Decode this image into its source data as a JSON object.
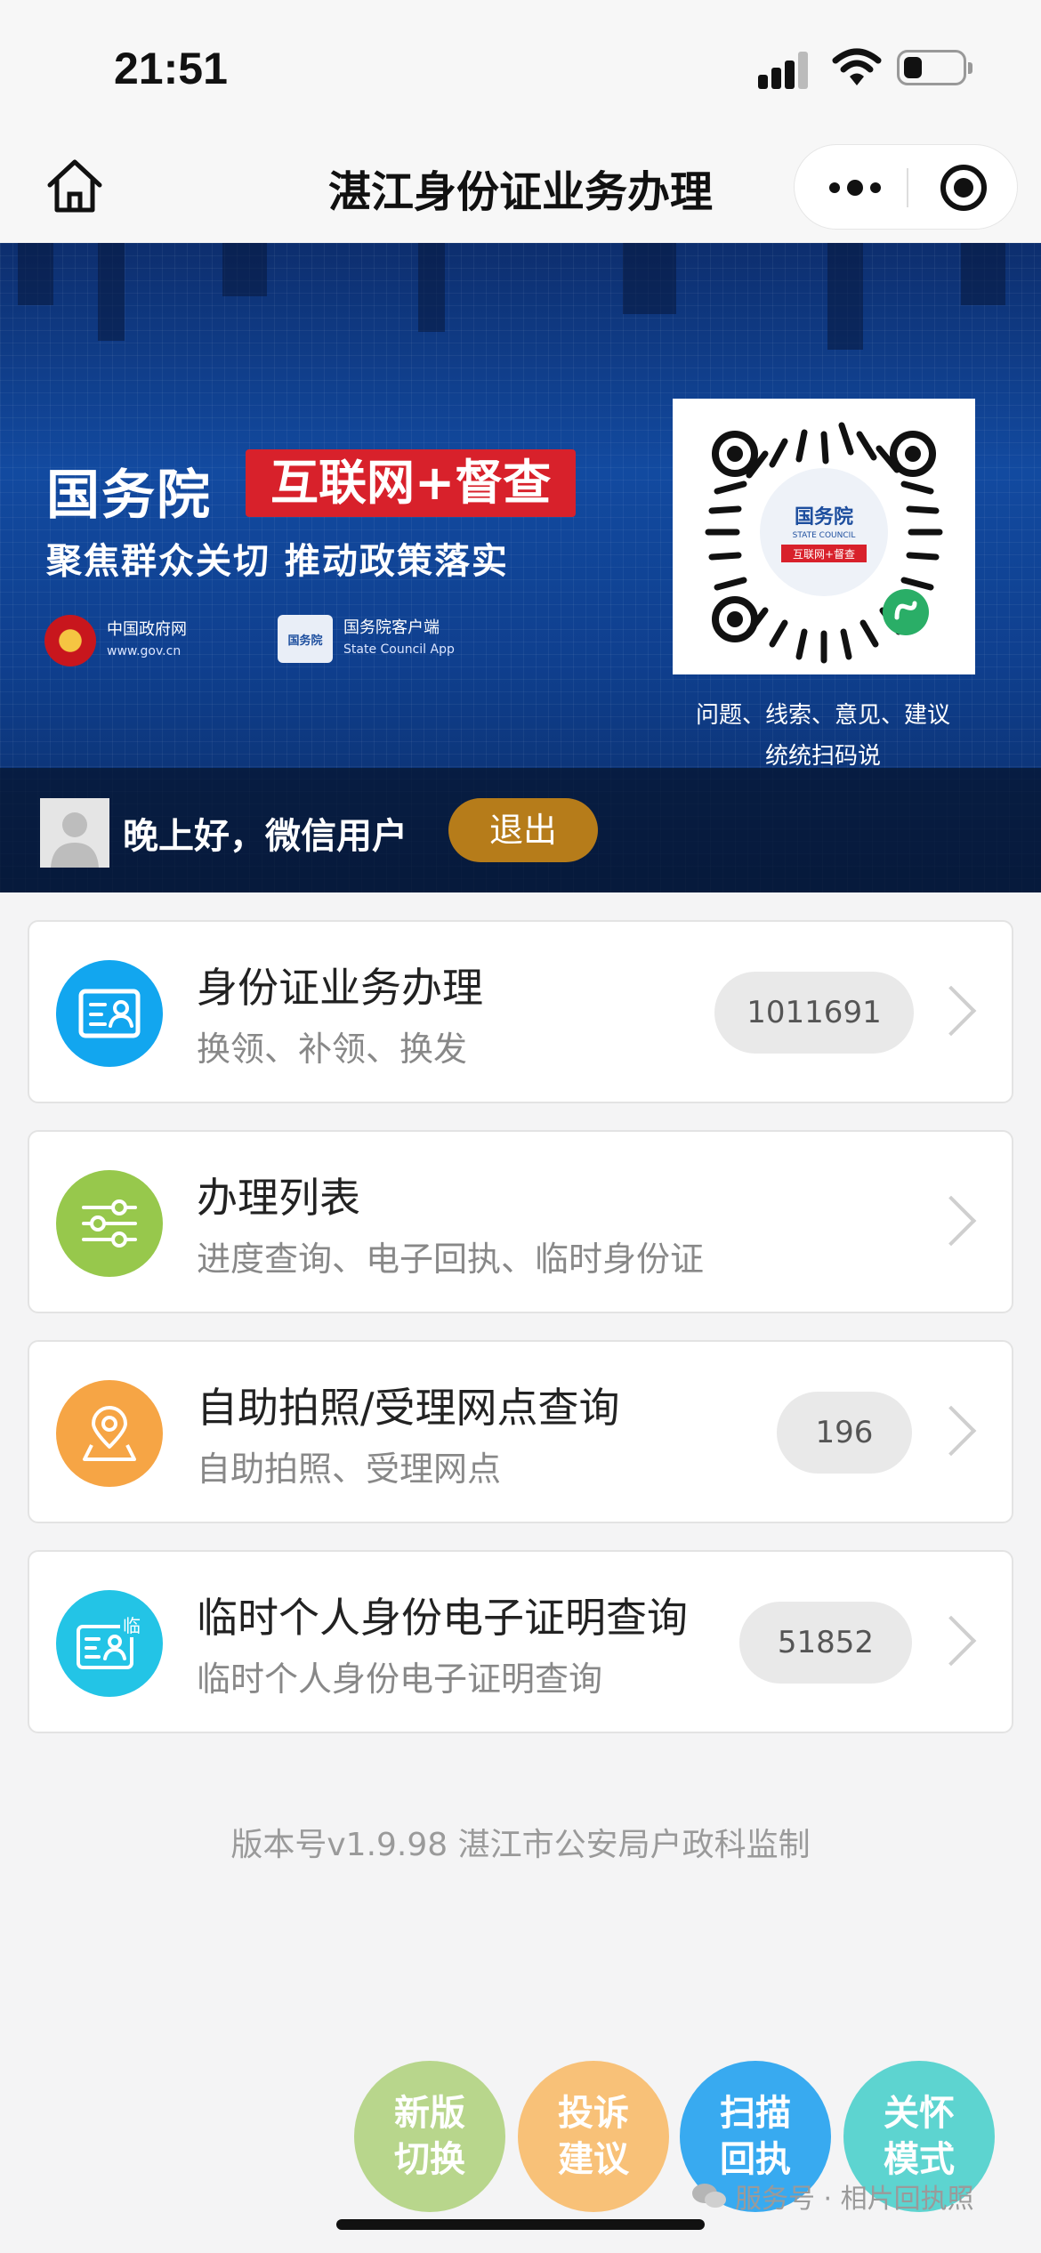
{
  "status_bar": {
    "time": "21:51"
  },
  "nav": {
    "title": "湛江身份证业务办理"
  },
  "banner": {
    "title": "国务院",
    "tag": "互联网+督查",
    "subtitle": "聚焦群众关切  推动政策落实",
    "logo_gov": "中国政府网",
    "logo_gov_url": "www.gov.cn",
    "logo_app_badge": "国务院",
    "logo_app": "国务院客户端",
    "logo_app_en": "State Council App",
    "qr_center_title": "国务院",
    "qr_center_en": "STATE COUNCIL",
    "qr_center_tag": "互联网+督查",
    "qr_caption_line1": "问题、线索、意见、建议",
    "qr_caption_line2": "统统扫码说"
  },
  "user": {
    "greeting": "晚上好，微信用户",
    "logout_label": "退出"
  },
  "menu": [
    {
      "title": "身份证业务办理",
      "subtitle": "换领、补领、换发",
      "count": "1011691",
      "color": "#12a6ef",
      "icon": "id-card-icon"
    },
    {
      "title": "办理列表",
      "subtitle": "进度查询、电子回执、临时身份证",
      "count": "",
      "color": "#97c84c",
      "icon": "sliders-icon"
    },
    {
      "title": "自助拍照/受理网点查询",
      "subtitle": "自助拍照、受理网点",
      "count": "196",
      "color": "#f6a545",
      "icon": "location-pin-icon"
    },
    {
      "title": "临时个人身份电子证明查询",
      "subtitle": "临时个人身份电子证明查询",
      "count": "51852",
      "color": "#23c4e6",
      "icon": "temp-id-card-icon",
      "icon_badge": "临"
    }
  ],
  "version": "版本号v1.9.98 湛江市公安局户政科监制",
  "fabs": [
    {
      "label": "新版切换",
      "color": "#b8d68c"
    },
    {
      "label": "投诉建议",
      "color": "#f8c178"
    },
    {
      "label": "扫描回执",
      "color": "#38aaf0"
    },
    {
      "label": "关怀模式",
      "color": "#5dd4d0"
    }
  ],
  "watermark": "服务号 · 相片回执照"
}
